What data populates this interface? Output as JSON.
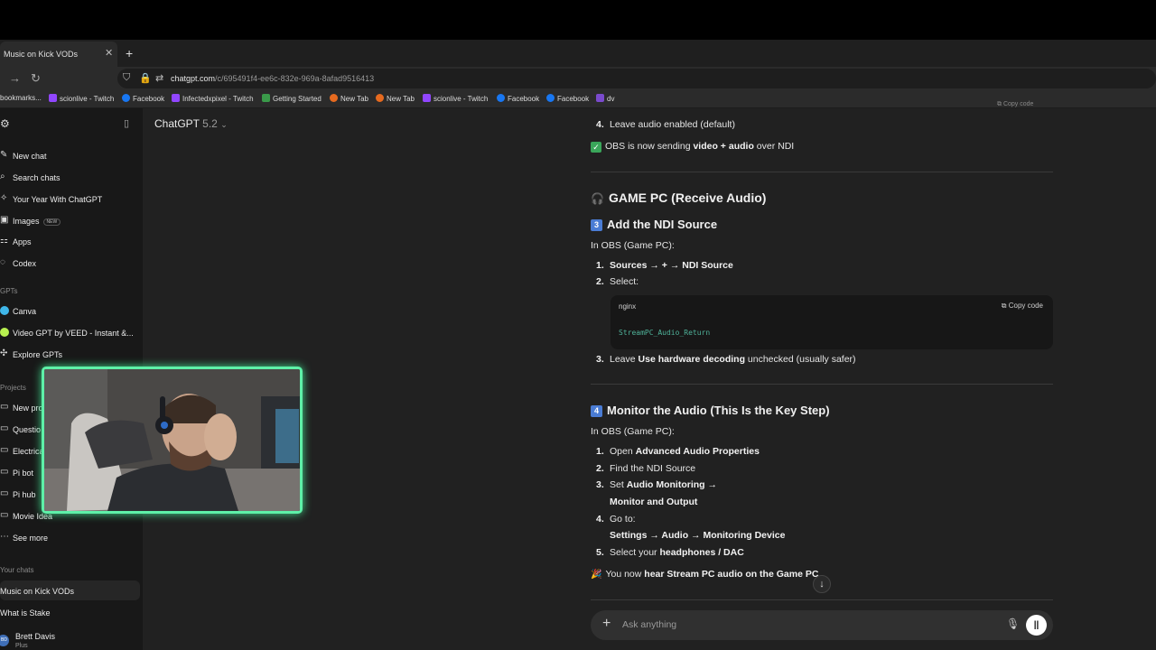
{
  "browser": {
    "tab_title": "Music on Kick VODs",
    "url_host": "chatgpt.com",
    "url_path": "/c/695491f4-ee6c-832e-969a-8afad9516413",
    "bookmarks": [
      {
        "label": "bookmarks...",
        "color": "#2b2b2b"
      },
      {
        "label": "scionlive - Twitch",
        "color": "#9146ff"
      },
      {
        "label": "Facebook",
        "color": "#1877f2"
      },
      {
        "label": "Infectedxpixel - Twitch",
        "color": "#9146ff"
      },
      {
        "label": "Getting Started",
        "color": "#3a9a4a"
      },
      {
        "label": "New Tab",
        "color": "#e66a1f"
      },
      {
        "label": "New Tab",
        "color": "#e66a1f"
      },
      {
        "label": "scionlive - Twitch",
        "color": "#9146ff"
      },
      {
        "label": "Facebook",
        "color": "#1877f2"
      },
      {
        "label": "Facebook",
        "color": "#1877f2"
      },
      {
        "label": "dv",
        "color": "#7a4acc"
      }
    ]
  },
  "sidebar": {
    "new_chat": "New chat",
    "search_chats": "Search chats",
    "year": "Your Year With ChatGPT",
    "images": "Images",
    "images_badge": "NEW",
    "apps": "Apps",
    "codex": "Codex",
    "gpts_heading": "GPTs",
    "gpts": [
      "Canva",
      "Video GPT by VEED - Instant &...",
      "Explore GPTs"
    ],
    "projects_heading": "Projects",
    "projects": [
      "New pro",
      "Questio",
      "Electrica",
      "Pi bot",
      "Pi hub",
      "Movie Idea"
    ],
    "see_more": "See more",
    "chats_heading": "Your chats",
    "chats": [
      "Music on Kick VODs",
      "What is Stake"
    ],
    "user_name": "Brett Davis",
    "user_plan": "Plus",
    "user_initials": "BD"
  },
  "header": {
    "model": "ChatGPT",
    "model_version": "5.2"
  },
  "message": {
    "prev_item_num": "4.",
    "prev_item": "Leave audio enabled (default)",
    "obs_status_pre": "OBS is now sending ",
    "obs_status_b1": "video + audio",
    "obs_status_post": " over NDI",
    "section_title": "GAME PC (Receive Audio)",
    "step3_badge": "3",
    "step3_title": "Add the NDI Source",
    "in_obs": "In OBS (Game PC):",
    "s3_items": [
      {
        "num": "1.",
        "bold": "Sources → + → NDI Source",
        "post": ""
      },
      {
        "num": "2.",
        "bold": "",
        "post": "Select:"
      }
    ],
    "code_lang": "nginx",
    "copy_code": "Copy code",
    "code_text": "StreamPC_Audio_Return",
    "s3_item3_num": "3.",
    "s3_item3_pre": "Leave ",
    "s3_item3_bold": "Use hardware decoding",
    "s3_item3_post": " unchecked (usually safer)",
    "step4_badge": "4",
    "step4_title": "Monitor the Audio (This Is the Key Step)",
    "in_obs2": "In OBS (Game PC):",
    "s4_item1_pre": "Open ",
    "s4_item1_bold": "Advanced Audio Properties",
    "s4_item2": "Find the NDI Source",
    "s4_item3_pre": "Set ",
    "s4_item3_bold1": "Audio Monitoring →",
    "s4_item3_bold2": "Monitor and Output",
    "s4_item4": "Go to:",
    "s4_item4_bold": "Settings → Audio → Monitoring Device",
    "s4_item5_pre": "Select your ",
    "s4_item5_bold": "headphones / DAC",
    "final_pre": "You now ",
    "final_bold": "hear Stream PC audio on the Game PC",
    "nums": [
      "1.",
      "2.",
      "3.",
      "4.",
      "5."
    ]
  },
  "composer": {
    "placeholder": "Ask anything"
  }
}
